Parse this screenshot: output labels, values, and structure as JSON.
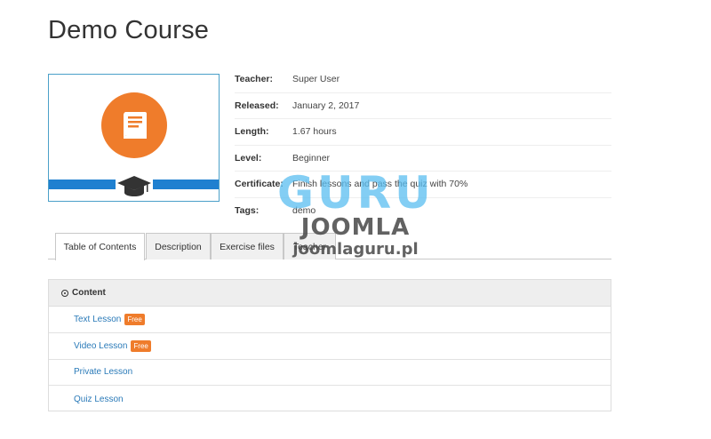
{
  "page": {
    "title": "Demo Course"
  },
  "course_image": {
    "icon": "book-icon",
    "secondary_icon": "graduation-cap-icon",
    "colors": {
      "circle": "#ef7c2b",
      "band": "#1f80d0"
    }
  },
  "course_info": [
    {
      "label": "Teacher:",
      "value": "Super User"
    },
    {
      "label": "Released:",
      "value": "January 2, 2017"
    },
    {
      "label": "Length:",
      "value": "1.67 hours"
    },
    {
      "label": "Level:",
      "value": "Beginner"
    },
    {
      "label": "Certificate:",
      "value": "Finish lessons and pass the quiz with 70%"
    },
    {
      "label": "Tags:",
      "value": "demo"
    }
  ],
  "tabs": [
    {
      "label": "Table of Contents",
      "active": true
    },
    {
      "label": "Description",
      "active": false
    },
    {
      "label": "Exercise files",
      "active": false
    },
    {
      "label": "Teacher",
      "active": false
    }
  ],
  "contents": {
    "header": "Content",
    "lessons": [
      {
        "title": "Text Lesson",
        "badge": "Free"
      },
      {
        "title": "Video Lesson",
        "badge": "Free"
      },
      {
        "title": "Private Lesson",
        "badge": ""
      },
      {
        "title": "Quiz Lesson",
        "badge": ""
      }
    ]
  },
  "watermark": {
    "line1": "GURU",
    "line2": "JOOMLA",
    "line3": "joomlaguru.pl"
  },
  "colors": {
    "link": "#2a7ab8",
    "badge": "#ef7c2b"
  }
}
